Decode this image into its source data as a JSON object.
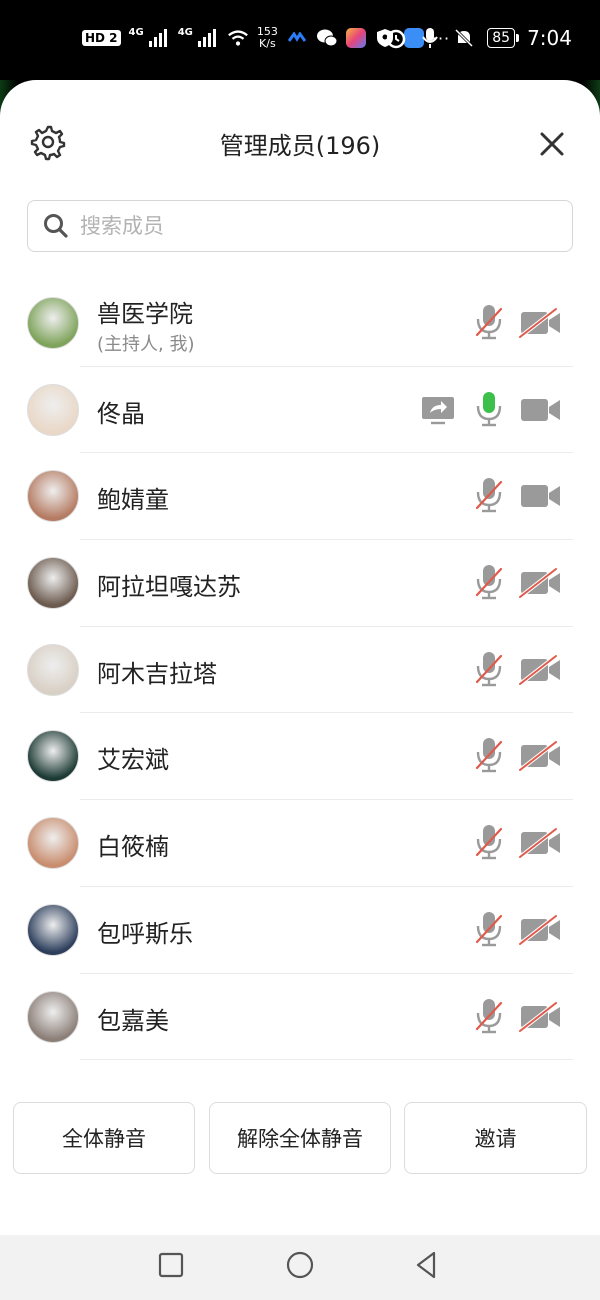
{
  "status_bar": {
    "hd": "HD 2",
    "net1": "4G",
    "net2": "4G",
    "speed_value": "153",
    "speed_unit": "K/s",
    "battery": "85",
    "time": "7:04",
    "more": "···"
  },
  "header": {
    "title": "管理成员(196)"
  },
  "search": {
    "placeholder": "搜索成员"
  },
  "members": [
    {
      "name": "兽医学院",
      "sub": "(主持人, 我)",
      "mic": "muted",
      "camera": "off",
      "sharing": false,
      "avatar_color": "#7ea35a"
    },
    {
      "name": "佟晶",
      "sub": "",
      "mic": "on",
      "camera": "on",
      "sharing": true,
      "avatar_color": "#e9d8c7"
    },
    {
      "name": "鲍婧童",
      "sub": "",
      "mic": "muted",
      "camera": "on",
      "sharing": false,
      "avatar_color": "#b57b62"
    },
    {
      "name": "阿拉坦嘎达苏",
      "sub": "",
      "mic": "muted",
      "camera": "off",
      "sharing": false,
      "avatar_color": "#6b5a4e"
    },
    {
      "name": "阿木吉拉塔",
      "sub": "",
      "mic": "muted",
      "camera": "off",
      "sharing": false,
      "avatar_color": "#d9d0c5"
    },
    {
      "name": "艾宏斌",
      "sub": "",
      "mic": "muted",
      "camera": "off",
      "sharing": false,
      "avatar_color": "#1c3a34"
    },
    {
      "name": "白筱楠",
      "sub": "",
      "mic": "muted",
      "camera": "off",
      "sharing": false,
      "avatar_color": "#c98d6e"
    },
    {
      "name": "包呼斯乐",
      "sub": "",
      "mic": "muted",
      "camera": "off",
      "sharing": false,
      "avatar_color": "#2c3e5c"
    },
    {
      "name": "包嘉美",
      "sub": "",
      "mic": "muted",
      "camera": "off",
      "sharing": false,
      "avatar_color": "#8c7f78"
    }
  ],
  "actions": {
    "mute_all": "全体静音",
    "unmute_all": "解除全体静音",
    "invite": "邀请"
  },
  "colors": {
    "mic_active": "#3cbf4b",
    "muted_slash": "#e05a4b",
    "icon_gray": "#9a9a9a"
  }
}
